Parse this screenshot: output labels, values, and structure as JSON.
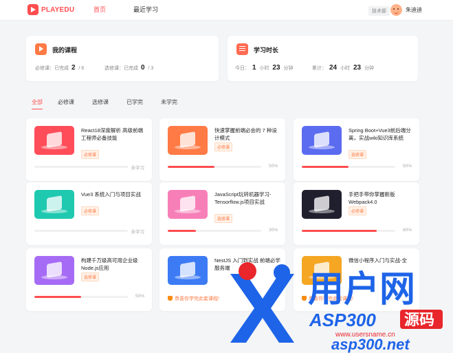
{
  "header": {
    "logo_text": "PLAYEDU",
    "nav": [
      {
        "label": "首页",
        "active": true
      },
      {
        "label": "最近学习",
        "active": false
      }
    ],
    "dept": "技术部",
    "user_name": "朱迪迪"
  },
  "stats": {
    "courses": {
      "title": "我的课程",
      "required_label": "必修课：已完成",
      "required_done": "2",
      "required_total": "/ 6",
      "elective_label": "选修课：已完成",
      "elective_done": "0",
      "elective_total": "/ 3"
    },
    "time": {
      "title": "学习时长",
      "today_label": "今日：",
      "today_hours": "1",
      "hour_unit": "小时",
      "today_minutes": "23",
      "minute_unit": "分钟",
      "total_label": "累计：",
      "total_hours": "24",
      "total_minutes": "23"
    }
  },
  "tabs": [
    "全部",
    "必修课",
    "选修课",
    "已学完",
    "未学完"
  ],
  "courses": [
    {
      "title": "React18深度解析 高级前端工程师必备技能",
      "tag": "必修课",
      "progress": 0,
      "status": "未学习",
      "color": "#ff4d5a"
    },
    {
      "title": "快速掌握前端必会的 7 种设计模式",
      "tag": "必修课",
      "progress": 50,
      "status": "50%",
      "color": "#ff7a45"
    },
    {
      "title": "Spring Boot+Vue3前后端分离，实战wiki知识库系统",
      "tag": "选修课",
      "progress": 50,
      "status": "50%",
      "color": "#5b6cf0"
    },
    {
      "title": "Vue3 系统入门与项目实战",
      "tag": "必修课",
      "progress": 0,
      "status": "未学习",
      "color": "#1fc9b0"
    },
    {
      "title": "JavaScript玩转机器学习-Tensorflow.js项目实战",
      "tag": "选修课",
      "progress": 30,
      "status": "30%",
      "color": "#f77fb8"
    },
    {
      "title": "手把手带你掌握新版Webpack4.0",
      "tag": "必修课",
      "progress": 80,
      "status": "80%",
      "color": "#1f1f2e"
    },
    {
      "title": "构建千万级高可用企业级Node.js应用",
      "tag": "选修课",
      "progress": 50,
      "status": "50%",
      "color": "#a66bf5"
    },
    {
      "title": "NestJS 入门到实战 前端必学服务端",
      "tag": "",
      "progress": 100,
      "status": "",
      "congrats": "恭喜你学完此套课程!",
      "color": "#3d7bf5"
    },
    {
      "title": "微信小程序入门与实战-全",
      "tag": "",
      "progress": 100,
      "status": "",
      "congrats": "恭喜你学完此套课程!",
      "color": "#f5a623"
    }
  ],
  "watermark": {
    "brand": "用户网",
    "site_asp": "ASP300",
    "site_red": "源码",
    "url1": "www.usersname.cn",
    "url2": "asp300.net",
    "colors": {
      "blue": "#1e64e8",
      "red": "#e8262b"
    }
  }
}
